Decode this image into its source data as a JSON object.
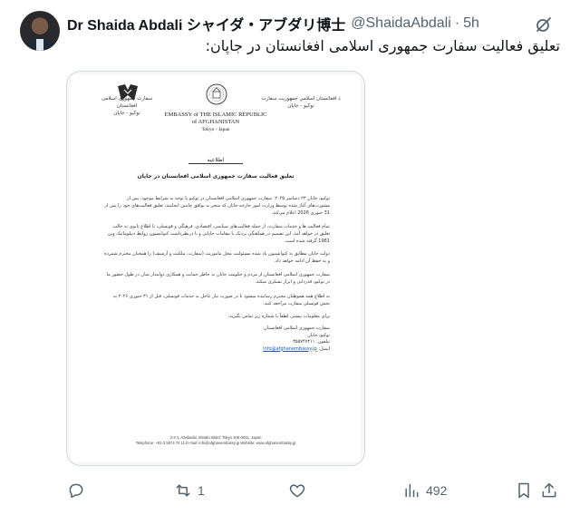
{
  "tweet": {
    "author_name": "Dr Shaida Abdali シャイダ・アブダリ博士",
    "handle": "@ShaidaAbdali",
    "separator": "·",
    "time": "5h",
    "text": "تعلیق فعالیت سفارت جمهوری اسلامی افغانستان در جاپان:"
  },
  "letter": {
    "header_right": [
      "د افغانستان اسلامي جمهوريت سفارت",
      "توکيو - جاپان"
    ],
    "header_left": [
      "سفارت جمهوری اسلامی افغانستان",
      "توکیو - جاپان"
    ],
    "header_center": [
      "EMBASSY of THE ISLAMIC REPUBLIC",
      "of AFGHANISTAN",
      "Tokyo - Japan"
    ],
    "notice_title": "اطلاعیه",
    "subject": "تعلیق فعالیت سفارت جمهوری اسلامی افغانستان در جاپان",
    "paragraphs": [
      "توکیو، جاپان ۲۳ دسامبر ۲۰۲۵: سفارت جمهوری اسلامی افغانستان در توکیو با توجه به شرایط موجود، پس از مشورت‌های آغاز شده توسط وزارت امور خارجه جاپان که منجر به توافق جانبین انجامید، تعلیق فعالیت‌های خود را پس از 31 جنوری 2026 اعلام می‌کند.",
      "تمام فعالیت ها و خدمات سفارت، از جمله فعالیت‌های سیاسی، اقتصادی، فرهنگی و قونسلی، تا اطلاع ثانوی به حالت تعلیق در خواهد آمد. این تصمیم در هماهنگی نزدیک با مقامات جاپانی و با درنظرداشت کنوانسیون روابط دیپلوماتیک وین 1961 گرفته شده است.",
      "دولت جاپان مطابق به کنوانسیون یاد شده مسئولیت محل ماموریت (سفارت، ملکیت و آرشیف) را همچنان محترم شمرده و به حفظ آن ادامه خواهد داد.",
      "سفارت جمهوری اسلامی افغانستان از مردم و حکومت جاپان به خاطر حمایت و همکاری دوامدار شان در طول حضور ما در توکیو، قدردانی و ابراز تشکری میکند.",
      "به اطلاع همه هموطنان محترم رسانیده میشود تا در صورت نیاز عاجل به خدمات قونسلی، قبل از ۳۱ جنوری ۲۰۲۶ به بخش قونسلی سفارت مراجعه کنند.",
      "برای معلومات بیشتر، لطفاً با شماره زیر تماس بگیرید:"
    ],
    "signature": [
      "سفارت جمهوری اسلامی افغانستان",
      "توکیو، جاپان",
      "تیلفون: ۰۳۵۵۷۴۷۴۱۱"
    ],
    "email_label": "ایمیل:",
    "email": "info@afghanembassy.jp",
    "footer": [
      "2-2-1, Azabudai, Minato Ward, Tokyo 106-0041, Japan",
      "Telephone: +81-3 5574 74 11 E-mail: info@afghanembassy.jp Website: www.afghanembassy.jp"
    ]
  },
  "actions": {
    "reply_count": "",
    "retweet_count": "1",
    "like_count": "",
    "views_count": "492"
  },
  "icons": {
    "reply": "reply-icon",
    "retweet": "retweet-icon",
    "like": "heart-icon",
    "views": "views-chart-icon",
    "bookmark": "bookmark-icon",
    "share": "share-icon",
    "grok": "grok-icon"
  }
}
